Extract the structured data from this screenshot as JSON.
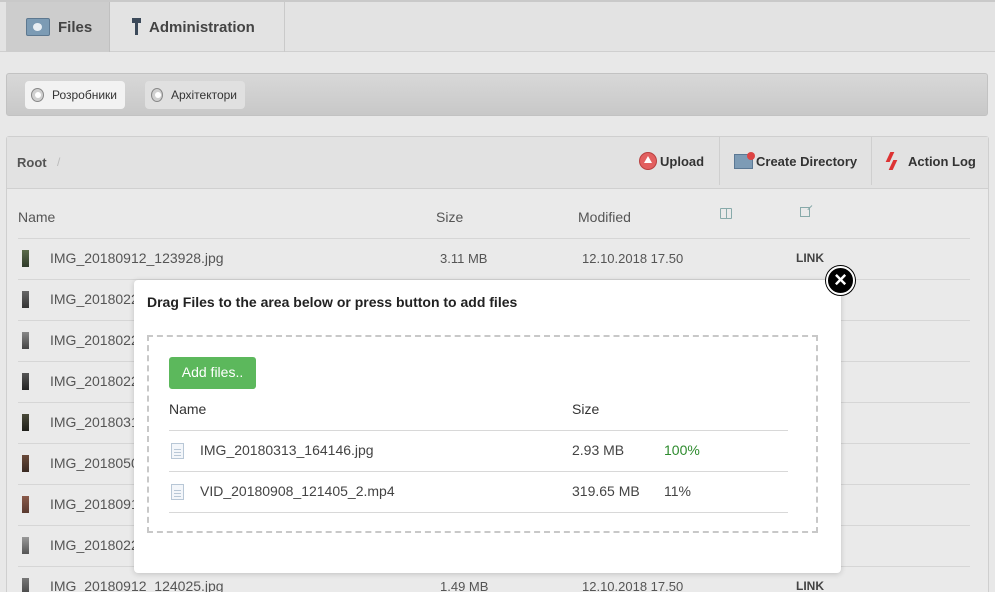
{
  "nav": {
    "tabs": [
      {
        "label": "Files",
        "icon": "files-icon",
        "active": true
      },
      {
        "label": "Administration",
        "icon": "admin-icon",
        "active": false
      }
    ]
  },
  "groups": [
    {
      "label": "Розробники",
      "icon": "disk-icon"
    },
    {
      "label": "Архітектори",
      "icon": "disk-icon"
    }
  ],
  "breadcrumb": {
    "root": "Root",
    "separator": "/"
  },
  "actions": {
    "upload": "Upload",
    "create_directory": "Create Directory",
    "action_log": "Action Log"
  },
  "table": {
    "headers": {
      "name": "Name",
      "size": "Size",
      "modified": "Modified"
    },
    "rows": [
      {
        "name": "IMG_20180912_123928.jpg",
        "size": "3.11 MB",
        "modified": "12.10.2018 17.50",
        "link": "LINK"
      },
      {
        "name": "IMG_2018022",
        "size": "",
        "modified": "",
        "link": ""
      },
      {
        "name": "IMG_2018022",
        "size": "",
        "modified": "",
        "link": ""
      },
      {
        "name": "IMG_2018022",
        "size": "",
        "modified": "",
        "link": ""
      },
      {
        "name": "IMG_2018031",
        "size": "",
        "modified": "",
        "link": ""
      },
      {
        "name": "IMG_2018050",
        "size": "",
        "modified": "",
        "link": ""
      },
      {
        "name": "IMG_2018091",
        "size": "",
        "modified": "",
        "link": ""
      },
      {
        "name": "IMG_2018022",
        "size": "",
        "modified": "",
        "link": ""
      },
      {
        "name": "IMG_20180912_124025.jpg",
        "size": "1.49 MB",
        "modified": "12.10.2018 17.50",
        "link": "LINK"
      }
    ]
  },
  "upload_modal": {
    "close_icon": "×",
    "title": "Drag Files to the area below or press button to add files",
    "add_button": "Add files..",
    "headers": {
      "name": "Name",
      "size": "Size"
    },
    "files": [
      {
        "name": "IMG_20180313_164146.jpg",
        "size": "2.93 MB",
        "progress": "100%",
        "progress_color": "#2e8b2e"
      },
      {
        "name": "VID_20180908_121405_2.mp4",
        "size": "319.65 MB",
        "progress": "11%",
        "progress_color": "#444444"
      }
    ]
  },
  "colors": {
    "accent_green": "#5cb85c"
  }
}
